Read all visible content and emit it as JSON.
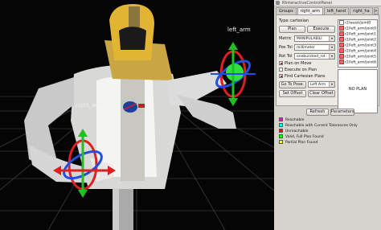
{
  "viewport": {
    "labels": {
      "left_arm": "left_arm",
      "right_arm": "right_arm"
    },
    "colors": {
      "background": "#050505",
      "grid": "#3a3a3a",
      "ring_red": "#e02020",
      "ring_blue": "#2050e0",
      "arrow_green": "#20c020",
      "goal_green": "#30e040"
    }
  },
  "panel": {
    "title": "RInteractiveControlPanel",
    "tabs": [
      {
        "label": "Groups",
        "active": false
      },
      {
        "label": "right_arm",
        "active": true
      },
      {
        "label": "left_hand",
        "active": false
      },
      {
        "label": "right_ha",
        "active": false
      }
    ],
    "tab_scroll_arrow": ">",
    "type_label": "Type:",
    "type_value": "cartesian",
    "plan_button": "Plan",
    "execute_button": "Execute",
    "metric_label": "Metric",
    "metric_value": "MANIPULABILI",
    "pos_tol_label": "Pos Tol",
    "pos_tol_value": "millimeter",
    "rot_tol_label": "Rot Tol",
    "rot_tol_value": "onebundred_rot",
    "plan_on_move": {
      "label": "Plan on Move",
      "checked": true
    },
    "execute_on_plan": {
      "label": "Execute on Plan",
      "checked": false
    },
    "find_cartesian": {
      "label": "Find Cartesian Plans",
      "checked": true
    },
    "go_to_pose_button": "Go To Pose:",
    "pose_value": "Left Arm",
    "set_offset_button": "Set Offset",
    "clear_offset_button": "Clear Offset",
    "goal_items": [
      {
        "label": "r2/waist/joint0",
        "checked": false
      },
      {
        "label": "r2/left_arm/joint0",
        "checked": true
      },
      {
        "label": "r2/left_arm/joint1",
        "checked": true
      },
      {
        "label": "r2/left_arm/joint2",
        "checked": true
      },
      {
        "label": "r2/left_arm/joint3",
        "checked": true
      },
      {
        "label": "r2/left_arm/joint4",
        "checked": true
      },
      {
        "label": "r2/left_arm/joint5",
        "checked": true
      },
      {
        "label": "r2/left_arm/joint6",
        "checked": true
      }
    ],
    "no_plan_text": "NO PLAN",
    "refresh_button": "Refresh",
    "parameters_button": "Parameters",
    "legend": [
      {
        "label": "Reachable",
        "color": "#ff00ff"
      },
      {
        "label": "Reachable with Current Tolerances Only",
        "color": "#00ffff"
      },
      {
        "label": "Unreachable",
        "color": "#ff0000"
      },
      {
        "label": "Valid, Full Plan Found",
        "color": "#00ff00"
      },
      {
        "label": "Partial Plan Found",
        "color": "#ffff00"
      }
    ]
  }
}
